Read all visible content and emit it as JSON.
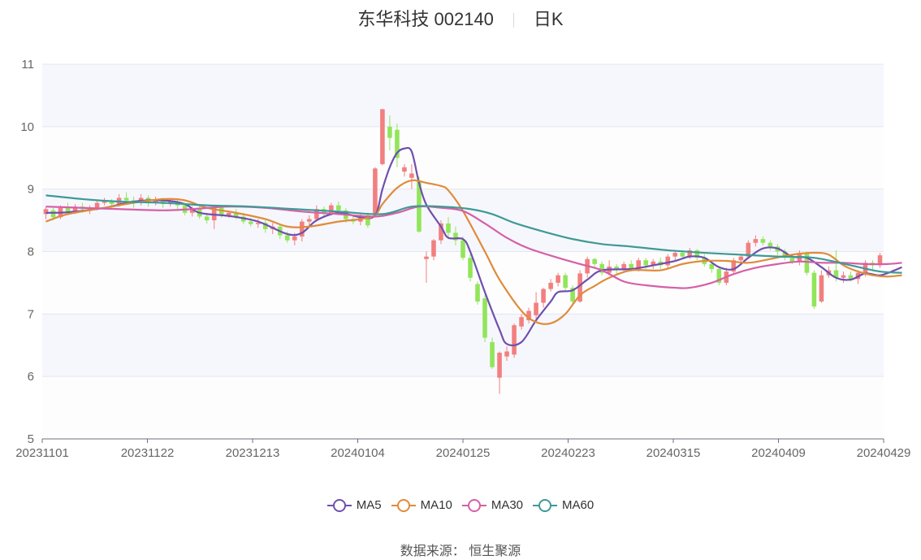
{
  "header": {
    "title": "东华科技 002140",
    "period": "日K"
  },
  "source": "数据来源： 恒生聚源",
  "chart_data": {
    "type": "candlestick",
    "ylim": [
      5,
      11
    ],
    "yticks": [
      "5",
      "6",
      "7",
      "8",
      "9",
      "10",
      "11"
    ],
    "xticks": [
      "20231101",
      "20231122",
      "20231213",
      "20240104",
      "20240125",
      "20240223",
      "20240315",
      "20240409",
      "20240429"
    ],
    "colors": {
      "up": "#f27f7f",
      "down": "#91e55a"
    },
    "candles": [
      [
        8.6,
        8.68,
        8.52,
        8.72
      ],
      [
        8.66,
        8.55,
        8.5,
        8.7
      ],
      [
        8.55,
        8.7,
        8.52,
        8.74
      ],
      [
        8.7,
        8.64,
        8.6,
        8.78
      ],
      [
        8.64,
        8.72,
        8.6,
        8.76
      ],
      [
        8.72,
        8.68,
        8.62,
        8.78
      ],
      [
        8.68,
        8.7,
        8.6,
        8.74
      ],
      [
        8.7,
        8.78,
        8.66,
        8.82
      ],
      [
        8.78,
        8.8,
        8.74,
        8.86
      ],
      [
        8.8,
        8.76,
        8.7,
        8.84
      ],
      [
        8.76,
        8.86,
        8.72,
        8.92
      ],
      [
        8.86,
        8.82,
        8.78,
        8.95
      ],
      [
        8.82,
        8.78,
        8.7,
        8.88
      ],
      [
        8.78,
        8.86,
        8.74,
        8.92
      ],
      [
        8.86,
        8.78,
        8.72,
        8.9
      ],
      [
        8.78,
        8.82,
        8.74,
        8.88
      ],
      [
        8.82,
        8.76,
        8.7,
        8.86
      ],
      [
        8.76,
        8.8,
        8.72,
        8.84
      ],
      [
        8.8,
        8.74,
        8.68,
        8.84
      ],
      [
        8.74,
        8.62,
        8.58,
        8.78
      ],
      [
        8.62,
        8.68,
        8.56,
        8.72
      ],
      [
        8.68,
        8.56,
        8.52,
        8.72
      ],
      [
        8.56,
        8.5,
        8.45,
        8.62
      ],
      [
        8.5,
        8.7,
        8.36,
        8.74
      ],
      [
        8.7,
        8.58,
        8.54,
        8.74
      ],
      [
        8.58,
        8.62,
        8.54,
        8.66
      ],
      [
        8.62,
        8.56,
        8.52,
        8.68
      ],
      [
        8.56,
        8.48,
        8.44,
        8.62
      ],
      [
        8.48,
        8.44,
        8.4,
        8.54
      ],
      [
        8.44,
        8.46,
        8.38,
        8.52
      ],
      [
        8.46,
        8.36,
        8.3,
        8.5
      ],
      [
        8.36,
        8.4,
        8.28,
        8.46
      ],
      [
        8.4,
        8.26,
        8.2,
        8.44
      ],
      [
        8.26,
        8.18,
        8.14,
        8.32
      ],
      [
        8.18,
        8.24,
        8.1,
        8.3
      ],
      [
        8.24,
        8.48,
        8.16,
        8.52
      ],
      [
        8.48,
        8.52,
        8.42,
        8.58
      ],
      [
        8.52,
        8.68,
        8.48,
        8.74
      ],
      [
        8.68,
        8.62,
        8.56,
        8.72
      ],
      [
        8.62,
        8.74,
        8.58,
        8.78
      ],
      [
        8.74,
        8.66,
        8.6,
        8.8
      ],
      [
        8.66,
        8.52,
        8.46,
        8.7
      ],
      [
        8.52,
        8.48,
        8.44,
        8.58
      ],
      [
        8.48,
        8.58,
        8.42,
        8.62
      ],
      [
        8.58,
        8.42,
        8.38,
        8.62
      ],
      [
        8.6,
        9.33,
        8.55,
        9.35
      ],
      [
        9.4,
        10.28,
        9.38,
        10.28
      ],
      [
        10.0,
        9.82,
        9.62,
        10.18
      ],
      [
        9.95,
        9.5,
        9.35,
        10.05
      ],
      [
        9.28,
        9.35,
        9.2,
        9.4
      ],
      [
        9.18,
        9.25,
        9.0,
        9.4
      ],
      [
        9.12,
        8.32,
        8.3,
        9.2
      ],
      [
        7.88,
        7.92,
        7.5,
        8.0
      ],
      [
        7.92,
        8.18,
        7.86,
        8.2
      ],
      [
        8.18,
        8.45,
        8.12,
        8.5
      ],
      [
        8.45,
        8.3,
        8.2,
        8.55
      ],
      [
        8.3,
        8.18,
        8.1,
        8.4
      ],
      [
        8.18,
        7.9,
        7.86,
        8.24
      ],
      [
        7.9,
        7.58,
        7.52,
        7.96
      ],
      [
        7.48,
        7.2,
        7.15,
        7.52
      ],
      [
        7.25,
        6.62,
        6.55,
        7.3
      ],
      [
        6.55,
        6.15,
        6.12,
        6.62
      ],
      [
        5.98,
        6.38,
        5.72,
        6.4
      ],
      [
        6.32,
        6.4,
        6.25,
        6.48
      ],
      [
        6.35,
        6.82,
        6.3,
        6.85
      ],
      [
        6.8,
        6.95,
        6.75,
        7.0
      ],
      [
        6.9,
        7.05,
        6.85,
        7.1
      ],
      [
        6.98,
        7.18,
        6.92,
        7.35
      ],
      [
        7.18,
        7.4,
        7.1,
        7.42
      ],
      [
        7.4,
        7.5,
        7.36,
        7.56
      ],
      [
        7.5,
        7.62,
        7.44,
        7.66
      ],
      [
        7.62,
        7.42,
        7.38,
        7.66
      ],
      [
        7.42,
        7.2,
        7.16,
        7.46
      ],
      [
        7.2,
        7.65,
        7.18,
        7.7
      ],
      [
        7.65,
        7.88,
        7.58,
        7.92
      ],
      [
        7.88,
        7.8,
        7.74,
        7.9
      ],
      [
        7.8,
        7.66,
        7.62,
        7.84
      ],
      [
        7.66,
        7.76,
        7.62,
        7.86
      ],
      [
        7.76,
        7.7,
        7.64,
        7.8
      ],
      [
        7.7,
        7.8,
        7.66,
        7.84
      ],
      [
        7.8,
        7.72,
        7.68,
        7.86
      ],
      [
        7.72,
        7.86,
        7.68,
        7.9
      ],
      [
        7.86,
        7.78,
        7.72,
        7.9
      ],
      [
        7.78,
        7.84,
        7.72,
        7.88
      ],
      [
        7.84,
        7.78,
        7.72,
        7.9
      ],
      [
        7.78,
        7.92,
        7.74,
        7.96
      ],
      [
        7.92,
        7.98,
        7.86,
        8.02
      ],
      [
        7.98,
        7.92,
        7.88,
        8.02
      ],
      [
        7.92,
        8.02,
        7.88,
        8.06
      ],
      [
        8.02,
        7.9,
        7.86,
        8.04
      ],
      [
        7.9,
        7.8,
        7.76,
        7.96
      ],
      [
        7.8,
        7.72,
        7.66,
        7.84
      ],
      [
        7.72,
        7.5,
        7.46,
        7.76
      ],
      [
        7.5,
        7.68,
        7.46,
        7.74
      ],
      [
        7.68,
        7.86,
        7.64,
        7.9
      ],
      [
        7.86,
        7.92,
        7.82,
        7.96
      ],
      [
        7.92,
        8.14,
        7.88,
        8.18
      ],
      [
        8.14,
        8.2,
        8.08,
        8.26
      ],
      [
        8.2,
        8.14,
        8.1,
        8.24
      ],
      [
        8.14,
        8.08,
        8.02,
        8.18
      ],
      [
        8.08,
        8.0,
        7.94,
        8.12
      ],
      [
        8.0,
        7.9,
        7.86,
        8.04
      ],
      [
        7.9,
        7.84,
        7.8,
        7.94
      ],
      [
        7.84,
        7.98,
        7.78,
        8.02
      ],
      [
        7.98,
        7.66,
        7.62,
        8.0
      ],
      [
        7.66,
        7.12,
        7.08,
        7.7
      ],
      [
        7.2,
        7.62,
        7.18,
        7.7
      ],
      [
        7.62,
        7.7,
        7.58,
        7.76
      ],
      [
        7.7,
        7.58,
        7.52,
        8.02
      ],
      [
        7.58,
        7.62,
        7.5,
        7.68
      ],
      [
        7.62,
        7.56,
        7.52,
        7.68
      ],
      [
        7.56,
        7.66,
        7.48,
        7.7
      ],
      [
        7.66,
        7.82,
        7.6,
        7.86
      ],
      [
        7.82,
        7.78,
        7.7,
        7.86
      ],
      [
        7.78,
        7.94,
        7.74,
        7.98
      ]
    ],
    "series": [
      {
        "name": "MA5",
        "color": "#6f4fae",
        "pts": [
          [
            0,
            8.62
          ],
          [
            3,
            8.63
          ],
          [
            8,
            8.7
          ],
          [
            12,
            8.8
          ],
          [
            16,
            8.82
          ],
          [
            19,
            8.76
          ],
          [
            21,
            8.62
          ],
          [
            25,
            8.57
          ],
          [
            29,
            8.48
          ],
          [
            33,
            8.28
          ],
          [
            35,
            8.3
          ],
          [
            37,
            8.5
          ],
          [
            40,
            8.62
          ],
          [
            43,
            8.55
          ],
          [
            45,
            8.58
          ],
          [
            46,
            9.0
          ],
          [
            47,
            9.35
          ],
          [
            48,
            9.58
          ],
          [
            49,
            9.65
          ],
          [
            50,
            9.6
          ],
          [
            51,
            9.1
          ],
          [
            52,
            8.75
          ],
          [
            54,
            8.4
          ],
          [
            55,
            8.22
          ],
          [
            57,
            8.2
          ],
          [
            58,
            8.0
          ],
          [
            60,
            7.35
          ],
          [
            62,
            6.75
          ],
          [
            63,
            6.52
          ],
          [
            65,
            6.55
          ],
          [
            67,
            6.9
          ],
          [
            69,
            7.2
          ],
          [
            70,
            7.35
          ],
          [
            72,
            7.38
          ],
          [
            74,
            7.55
          ],
          [
            76,
            7.7
          ],
          [
            80,
            7.72
          ],
          [
            83,
            7.78
          ],
          [
            86,
            7.85
          ],
          [
            88,
            7.92
          ],
          [
            90,
            7.9
          ],
          [
            92,
            7.75
          ],
          [
            94,
            7.72
          ],
          [
            96,
            7.9
          ],
          [
            98,
            8.05
          ],
          [
            100,
            8.05
          ],
          [
            102,
            7.92
          ],
          [
            104,
            7.9
          ],
          [
            106,
            7.75
          ],
          [
            108,
            7.58
          ],
          [
            110,
            7.55
          ],
          [
            112,
            7.65
          ],
          [
            114,
            7.62
          ],
          [
            116,
            7.7
          ],
          [
            117,
            7.75
          ]
        ]
      },
      {
        "name": "MA10",
        "color": "#e08b3a",
        "pts": [
          [
            0,
            8.48
          ],
          [
            3,
            8.6
          ],
          [
            8,
            8.7
          ],
          [
            12,
            8.78
          ],
          [
            16,
            8.84
          ],
          [
            19,
            8.82
          ],
          [
            22,
            8.7
          ],
          [
            26,
            8.62
          ],
          [
            30,
            8.52
          ],
          [
            33,
            8.4
          ],
          [
            36,
            8.4
          ],
          [
            40,
            8.48
          ],
          [
            43,
            8.52
          ],
          [
            45,
            8.58
          ],
          [
            46,
            8.76
          ],
          [
            48,
            9.02
          ],
          [
            50,
            9.14
          ],
          [
            52,
            9.1
          ],
          [
            54,
            9.05
          ],
          [
            55,
            8.98
          ],
          [
            57,
            8.65
          ],
          [
            60,
            8.0
          ],
          [
            62,
            7.55
          ],
          [
            65,
            7.05
          ],
          [
            67,
            6.87
          ],
          [
            69,
            6.85
          ],
          [
            71,
            7.0
          ],
          [
            73,
            7.3
          ],
          [
            75,
            7.45
          ],
          [
            77,
            7.58
          ],
          [
            80,
            7.7
          ],
          [
            84,
            7.7
          ],
          [
            87,
            7.8
          ],
          [
            90,
            7.85
          ],
          [
            93,
            7.85
          ],
          [
            96,
            7.82
          ],
          [
            99,
            7.88
          ],
          [
            102,
            7.95
          ],
          [
            105,
            7.98
          ],
          [
            107,
            7.95
          ],
          [
            109,
            7.78
          ],
          [
            111,
            7.68
          ],
          [
            113,
            7.62
          ],
          [
            115,
            7.6
          ],
          [
            117,
            7.62
          ]
        ]
      },
      {
        "name": "MA30",
        "color": "#d65fa8",
        "pts": [
          [
            0,
            8.72
          ],
          [
            5,
            8.7
          ],
          [
            10,
            8.68
          ],
          [
            16,
            8.66
          ],
          [
            20,
            8.68
          ],
          [
            25,
            8.72
          ],
          [
            30,
            8.7
          ],
          [
            35,
            8.64
          ],
          [
            40,
            8.6
          ],
          [
            45,
            8.56
          ],
          [
            48,
            8.62
          ],
          [
            51,
            8.72
          ],
          [
            54,
            8.7
          ],
          [
            57,
            8.65
          ],
          [
            60,
            8.45
          ],
          [
            63,
            8.22
          ],
          [
            66,
            8.05
          ],
          [
            70,
            7.9
          ],
          [
            73,
            7.8
          ],
          [
            76,
            7.7
          ],
          [
            79,
            7.52
          ],
          [
            82,
            7.46
          ],
          [
            86,
            7.42
          ],
          [
            88,
            7.42
          ],
          [
            91,
            7.5
          ],
          [
            94,
            7.64
          ],
          [
            97,
            7.74
          ],
          [
            100,
            7.8
          ],
          [
            103,
            7.84
          ],
          [
            106,
            7.82
          ],
          [
            109,
            7.82
          ],
          [
            112,
            7.8
          ],
          [
            115,
            7.8
          ],
          [
            117,
            7.82
          ]
        ]
      },
      {
        "name": "MA60",
        "color": "#3e9a96",
        "pts": [
          [
            0,
            8.9
          ],
          [
            5,
            8.84
          ],
          [
            10,
            8.8
          ],
          [
            16,
            8.78
          ],
          [
            22,
            8.74
          ],
          [
            28,
            8.72
          ],
          [
            34,
            8.68
          ],
          [
            40,
            8.64
          ],
          [
            46,
            8.6
          ],
          [
            50,
            8.72
          ],
          [
            54,
            8.72
          ],
          [
            58,
            8.68
          ],
          [
            61,
            8.6
          ],
          [
            64,
            8.46
          ],
          [
            68,
            8.32
          ],
          [
            72,
            8.2
          ],
          [
            76,
            8.12
          ],
          [
            80,
            8.08
          ],
          [
            85,
            8.02
          ],
          [
            90,
            7.98
          ],
          [
            95,
            7.95
          ],
          [
            100,
            7.92
          ],
          [
            105,
            7.9
          ],
          [
            110,
            7.78
          ],
          [
            114,
            7.68
          ],
          [
            117,
            7.66
          ]
        ]
      }
    ]
  }
}
